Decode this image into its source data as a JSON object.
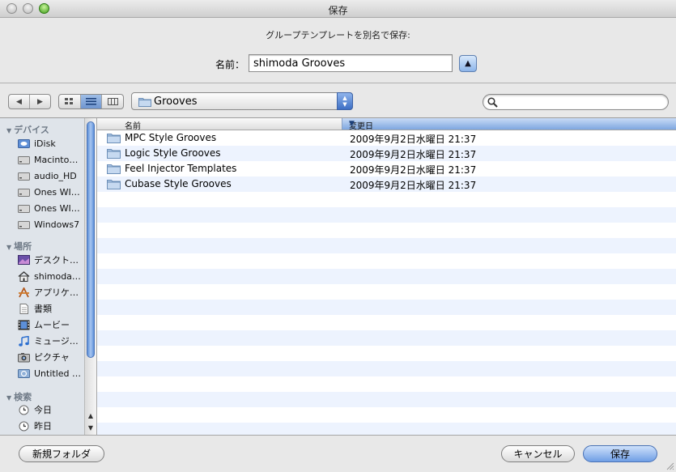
{
  "window": {
    "title": "保存"
  },
  "dialog": {
    "prompt": "グループテンプレートを別名で保存:",
    "name_label": "名前：",
    "name_value": "shimoda Grooves"
  },
  "toolbar": {
    "location": "Grooves",
    "search_placeholder": ""
  },
  "sidebar": {
    "sections": [
      {
        "title": "デバイス",
        "items": [
          {
            "label": "iDisk",
            "icon": "idisk-icon"
          },
          {
            "label": "Macinto…",
            "icon": "hard-drive-icon"
          },
          {
            "label": "audio_HD",
            "icon": "hard-drive-icon"
          },
          {
            "label": "Ones WI…",
            "icon": "hard-drive-icon"
          },
          {
            "label": "Ones WI…",
            "icon": "hard-drive-icon"
          },
          {
            "label": "Windows7",
            "icon": "hard-drive-icon"
          }
        ]
      },
      {
        "title": "場所",
        "items": [
          {
            "label": "デスクト…",
            "icon": "desktop-icon"
          },
          {
            "label": "shimoda…",
            "icon": "home-icon"
          },
          {
            "label": "アプリケ…",
            "icon": "applications-icon"
          },
          {
            "label": "書類",
            "icon": "documents-icon"
          },
          {
            "label": "ムービー",
            "icon": "movies-icon"
          },
          {
            "label": "ミュージ…",
            "icon": "music-icon"
          },
          {
            "label": "ピクチャ",
            "icon": "pictures-icon"
          },
          {
            "label": "Untitled …",
            "icon": "network-volume-icon"
          }
        ]
      },
      {
        "title": "検索",
        "items": [
          {
            "label": "今日",
            "icon": "clock-icon"
          },
          {
            "label": "昨日",
            "icon": "clock-icon"
          }
        ]
      }
    ]
  },
  "filelist": {
    "columns": {
      "name": "名前",
      "date": "変更日"
    },
    "rows": [
      {
        "name": "MPC Style Grooves",
        "date": "2009年9月2日水曜日 21:37"
      },
      {
        "name": "Logic Style Grooves",
        "date": "2009年9月2日水曜日 21:37"
      },
      {
        "name": "Feel Injector Templates",
        "date": "2009年9月2日水曜日 21:37"
      },
      {
        "name": "Cubase Style Grooves",
        "date": "2009年9月2日水曜日 21:37"
      }
    ]
  },
  "buttons": {
    "new_folder": "新規フォルダ",
    "cancel": "キャンセル",
    "save": "保存"
  },
  "colors": {
    "accent": "#6f9ee5",
    "alt_row": "#edf3fe",
    "sidebar_bg": "#dfe4ea"
  }
}
